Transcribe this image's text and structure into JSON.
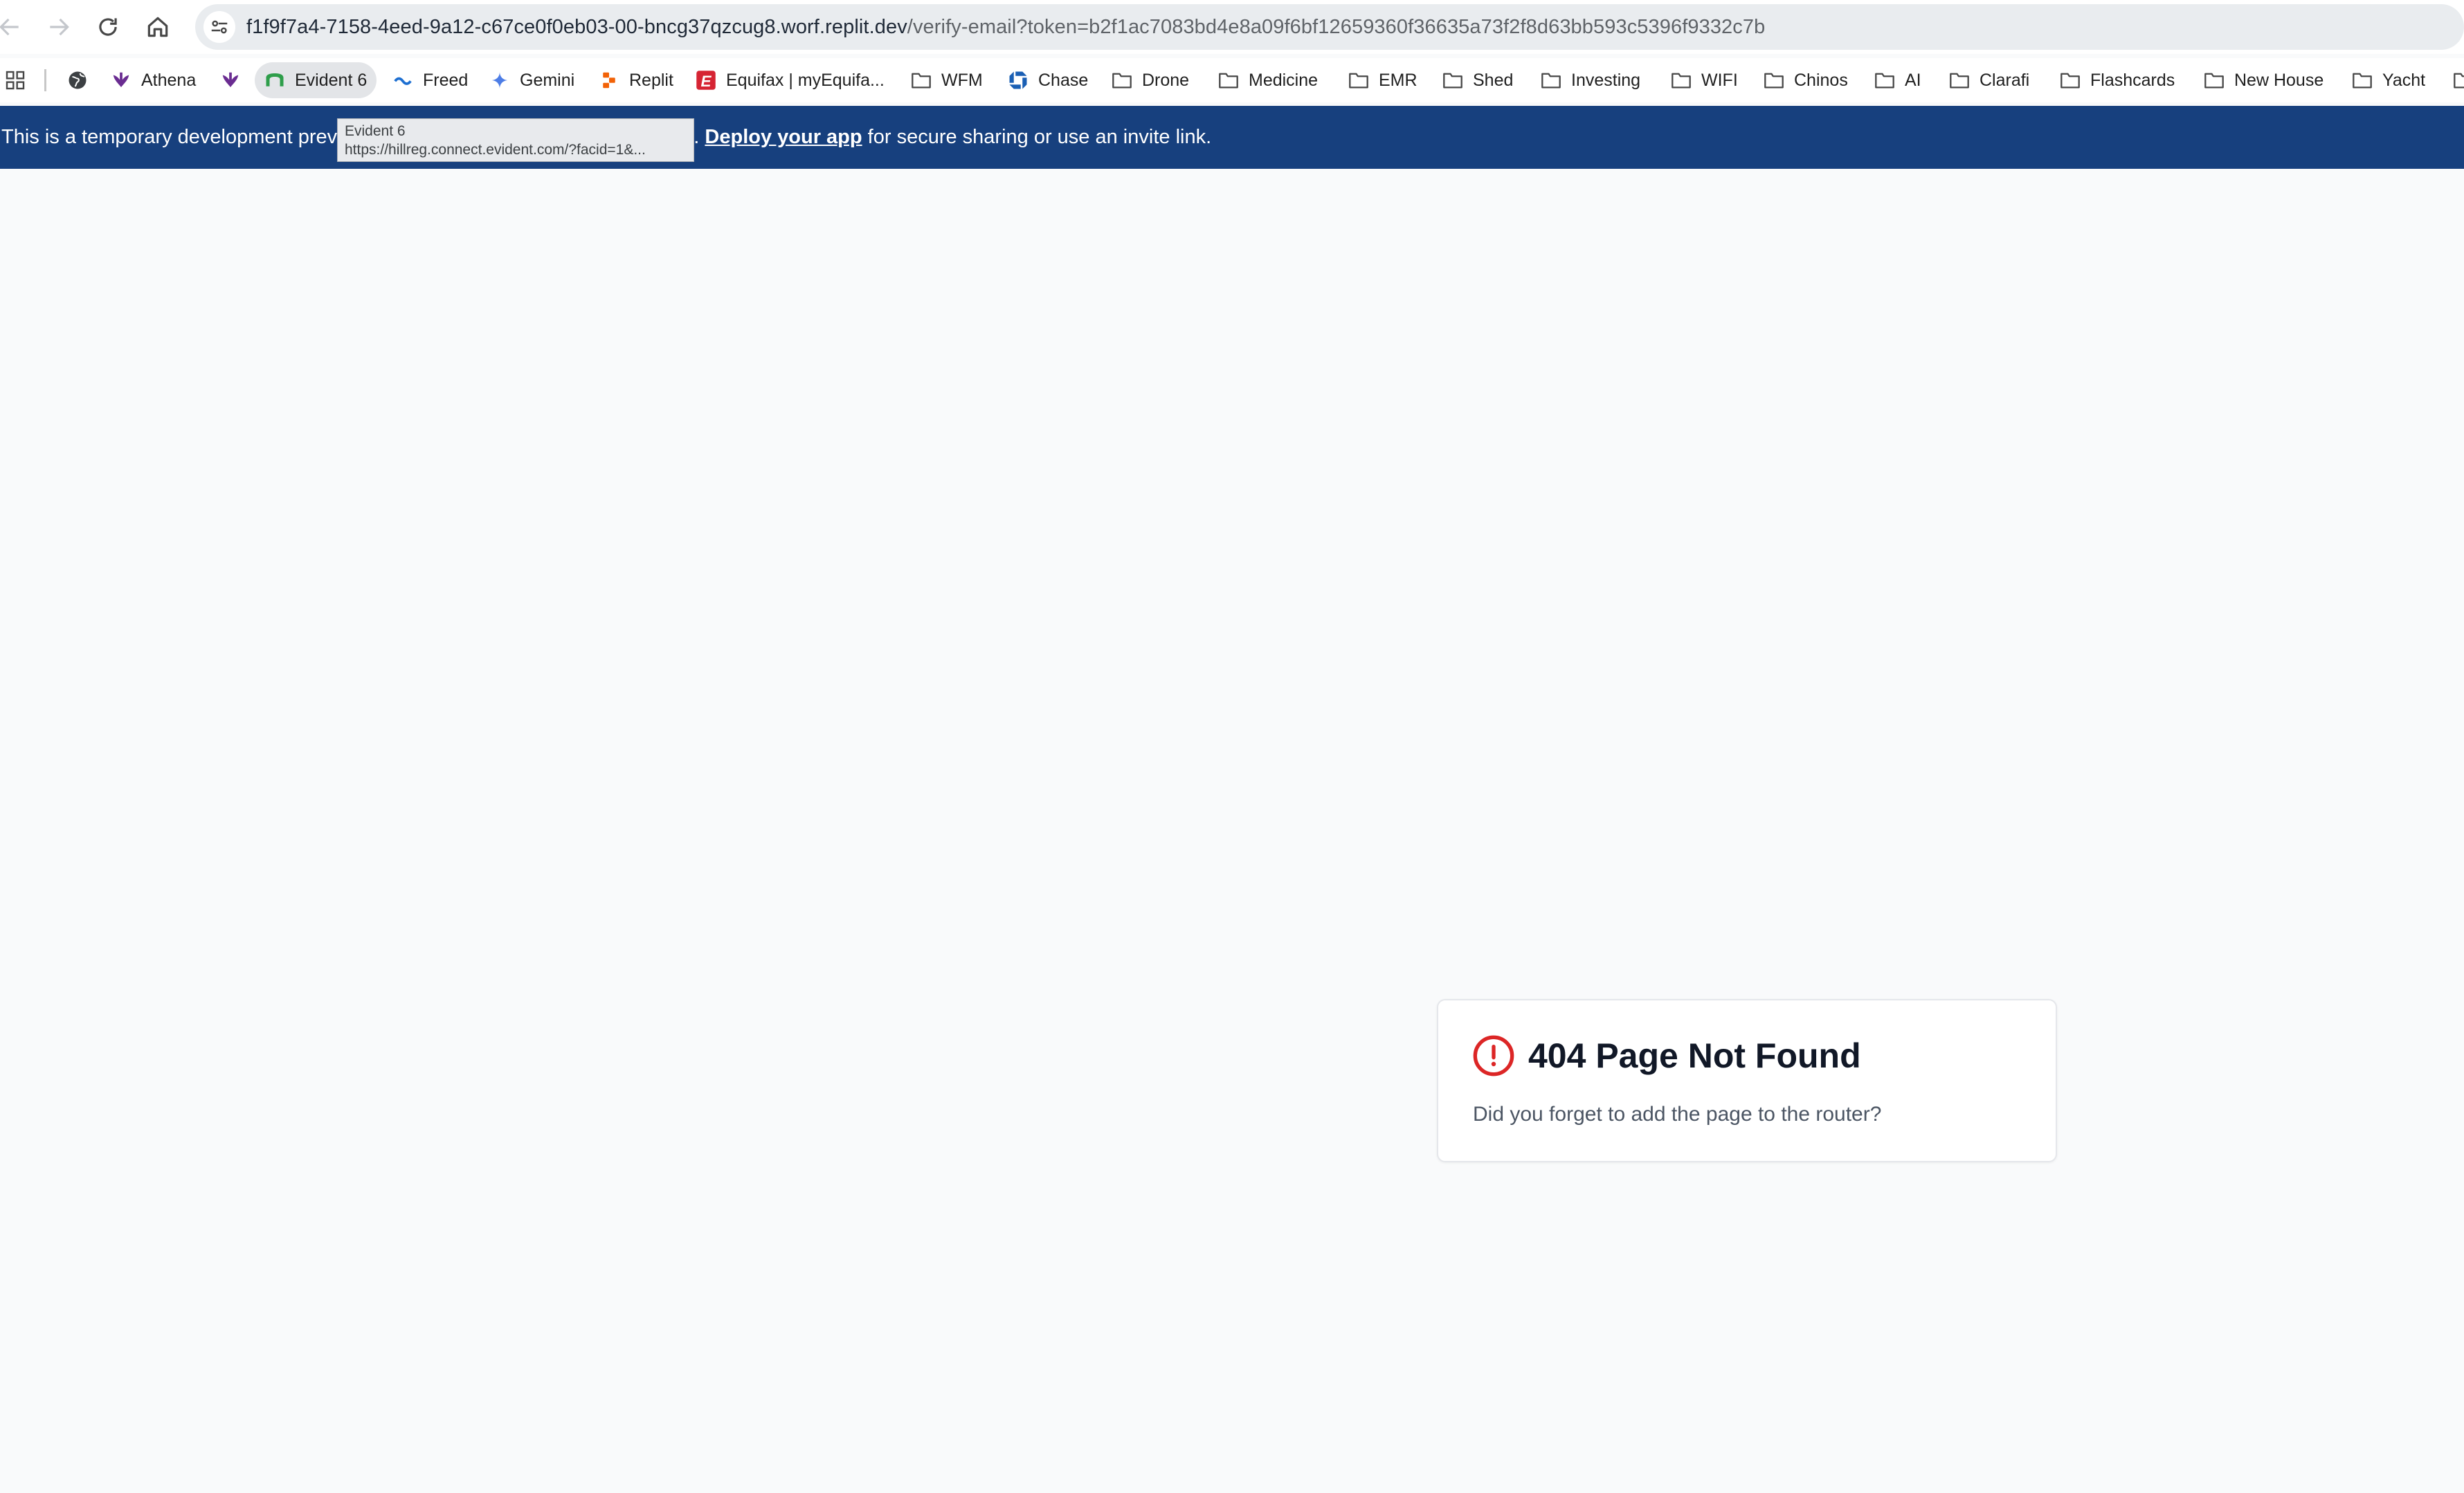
{
  "browser": {
    "url_host": "f1f9f7a4-7158-4eed-9a12-c67ce0f0eb03-00-bncg37qzcug8.worf.replit.dev",
    "url_path": "/verify-email?token=b2f1ac7083bd4e8a09f6bf12659360f36635a73f2f8d63bb593c5396f9332c7b",
    "nav_icons": [
      "back-arrow-icon",
      "forward-arrow-icon",
      "reload-icon",
      "home-icon",
      "site-info-icon"
    ]
  },
  "bookmarks": [
    {
      "label": "",
      "icon": "globe-icon"
    },
    {
      "label": "Athena",
      "icon": "athena-icon"
    },
    {
      "label": "",
      "icon": "athena-icon"
    },
    {
      "label": "Evident 6",
      "icon": "evident-icon"
    },
    {
      "label": "Freed",
      "icon": "freed-icon"
    },
    {
      "label": "Gemini",
      "icon": "gemini-icon"
    },
    {
      "label": "Replit",
      "icon": "replit-icon"
    },
    {
      "label": "Equifax | myEquifa...",
      "icon": "equifax-icon"
    },
    {
      "label": "WFM",
      "icon": "folder-icon"
    },
    {
      "label": "Chase",
      "icon": "chase-icon"
    },
    {
      "label": "Drone",
      "icon": "folder-icon"
    },
    {
      "label": "Medicine",
      "icon": "folder-icon"
    },
    {
      "label": "EMR",
      "icon": "folder-icon"
    },
    {
      "label": "Shed",
      "icon": "folder-icon"
    },
    {
      "label": "Investing",
      "icon": "folder-icon"
    },
    {
      "label": "WIFI",
      "icon": "folder-icon"
    },
    {
      "label": "Chinos",
      "icon": "folder-icon"
    },
    {
      "label": "AI",
      "icon": "folder-icon"
    },
    {
      "label": "Clarafi",
      "icon": "folder-icon"
    },
    {
      "label": "Flashcards",
      "icon": "folder-icon"
    },
    {
      "label": "New House",
      "icon": "folder-icon"
    },
    {
      "label": "Yacht",
      "icon": "folder-icon"
    }
  ],
  "tooltip": {
    "title": "Evident 6",
    "url": "https://hillreg.connect.evident.com/?facid=1&..."
  },
  "banner": {
    "text_before": "This is a temporary development prev",
    "text_mid": "e. ",
    "link": "Deploy your app",
    "text_after": " for secure sharing or use an invite link."
  },
  "error_card": {
    "title": "404 Page Not Found",
    "message": "Did you forget to add the page to the router?",
    "icon": "alert-circle-icon",
    "color": "#dc2626"
  },
  "colors": {
    "banner_bg": "#17407e",
    "page_bg": "#f9fafb"
  }
}
